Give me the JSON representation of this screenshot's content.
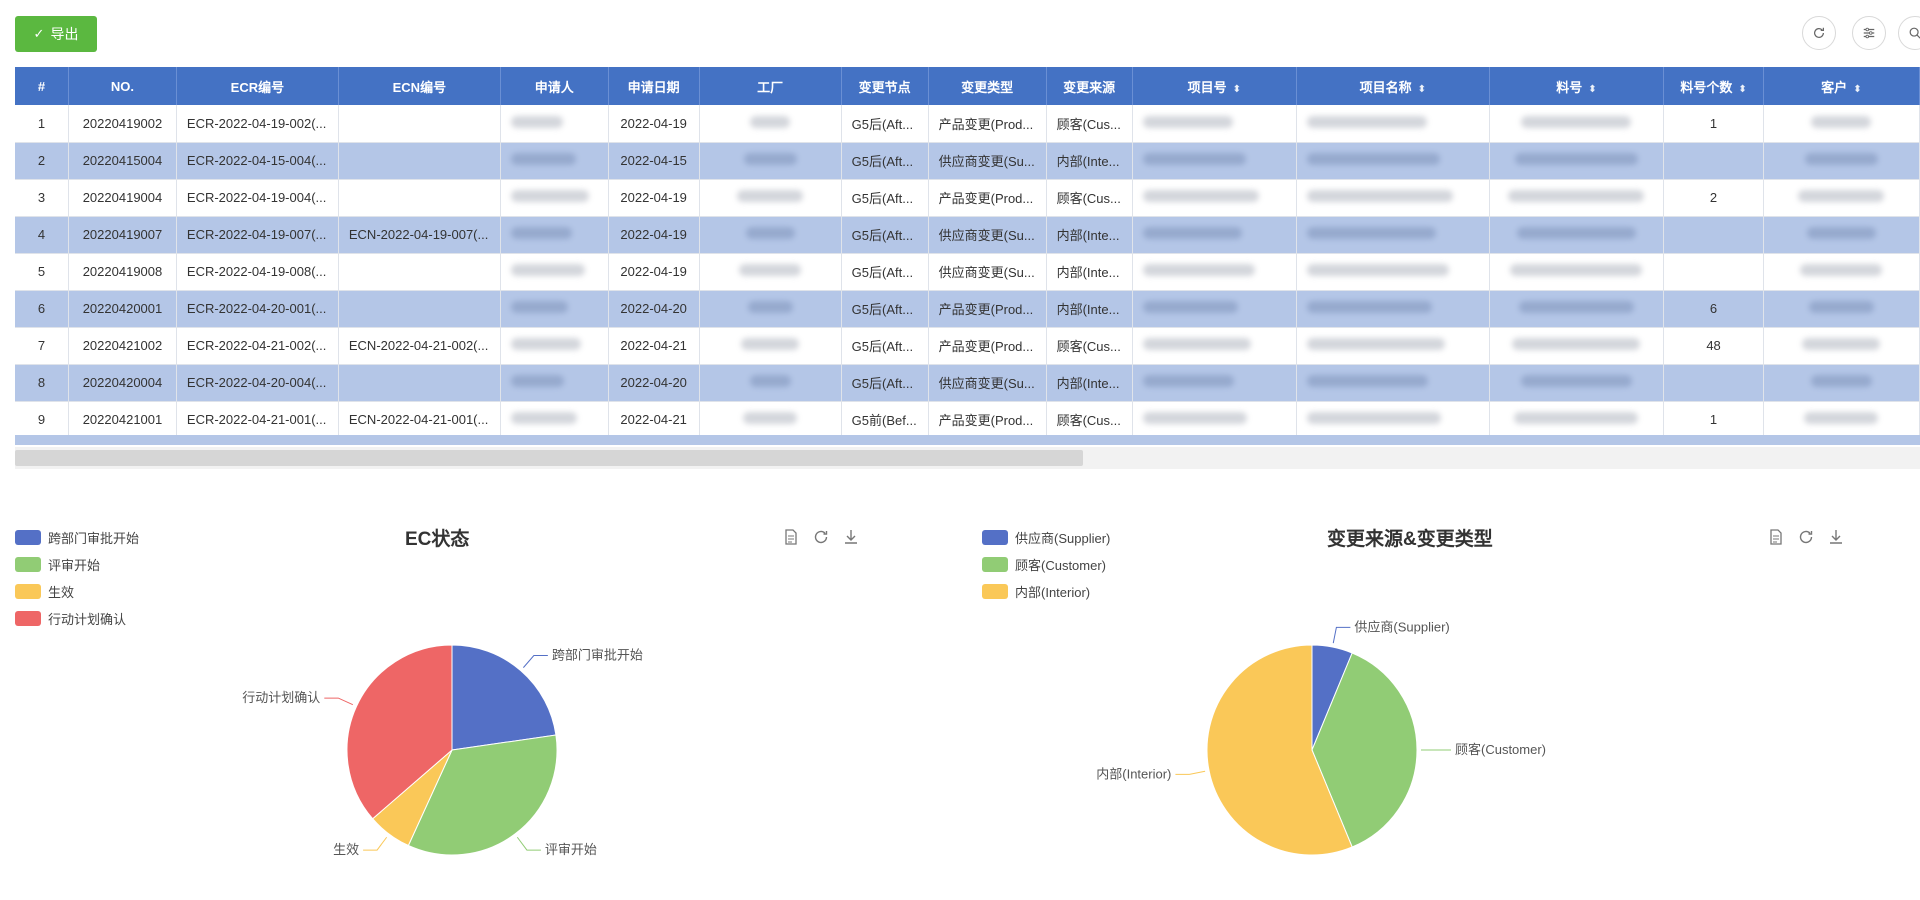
{
  "toolbar": {
    "export_label": "导出",
    "icons": [
      "refresh-icon",
      "filter-settings-icon",
      "search-icon"
    ]
  },
  "table": {
    "columns": [
      {
        "label": "#",
        "sortable": false
      },
      {
        "label": "NO.",
        "sortable": false
      },
      {
        "label": "ECR编号",
        "sortable": false
      },
      {
        "label": "ECN编号",
        "sortable": false
      },
      {
        "label": "申请人",
        "sortable": false
      },
      {
        "label": "申请日期",
        "sortable": false
      },
      {
        "label": "工厂",
        "sortable": false
      },
      {
        "label": "变更节点",
        "sortable": false
      },
      {
        "label": "变更类型",
        "sortable": false
      },
      {
        "label": "变更来源",
        "sortable": false
      },
      {
        "label": "项目号",
        "sortable": true
      },
      {
        "label": "项目名称",
        "sortable": true
      },
      {
        "label": "料号",
        "sortable": true
      },
      {
        "label": "料号个数",
        "sortable": true
      },
      {
        "label": "客户",
        "sortable": true
      }
    ],
    "rows": [
      {
        "idx": "1",
        "no": "20220419002",
        "ecr": "ECR-2022-04-19-002(...",
        "ecn": "",
        "date": "2022-04-19",
        "node": "G5后(Aft...",
        "type": "产品变更(Prod...",
        "source": "顾客(Cus...",
        "qty": "1"
      },
      {
        "idx": "2",
        "no": "20220415004",
        "ecr": "ECR-2022-04-15-004(...",
        "ecn": "",
        "date": "2022-04-15",
        "node": "G5后(Aft...",
        "type": "供应商变更(Su...",
        "source": "内部(Inte...",
        "qty": ""
      },
      {
        "idx": "3",
        "no": "20220419004",
        "ecr": "ECR-2022-04-19-004(...",
        "ecn": "",
        "date": "2022-04-19",
        "node": "G5后(Aft...",
        "type": "产品变更(Prod...",
        "source": "顾客(Cus...",
        "qty": "2"
      },
      {
        "idx": "4",
        "no": "20220419007",
        "ecr": "ECR-2022-04-19-007(...",
        "ecn": "ECN-2022-04-19-007(...",
        "date": "2022-04-19",
        "node": "G5后(Aft...",
        "type": "供应商变更(Su...",
        "source": "内部(Inte...",
        "qty": ""
      },
      {
        "idx": "5",
        "no": "20220419008",
        "ecr": "ECR-2022-04-19-008(...",
        "ecn": "",
        "date": "2022-04-19",
        "node": "G5后(Aft...",
        "type": "供应商变更(Su...",
        "source": "内部(Inte...",
        "qty": ""
      },
      {
        "idx": "6",
        "no": "20220420001",
        "ecr": "ECR-2022-04-20-001(...",
        "ecn": "",
        "date": "2022-04-20",
        "node": "G5后(Aft...",
        "type": "产品变更(Prod...",
        "source": "内部(Inte...",
        "qty": "6"
      },
      {
        "idx": "7",
        "no": "20220421002",
        "ecr": "ECR-2022-04-21-002(...",
        "ecn": "ECN-2022-04-21-002(...",
        "date": "2022-04-21",
        "node": "G5后(Aft...",
        "type": "产品变更(Prod...",
        "source": "顾客(Cus...",
        "qty": "48"
      },
      {
        "idx": "8",
        "no": "20220420004",
        "ecr": "ECR-2022-04-20-004(...",
        "ecn": "",
        "date": "2022-04-20",
        "node": "G5后(Aft...",
        "type": "供应商变更(Su...",
        "source": "内部(Inte...",
        "qty": ""
      },
      {
        "idx": "9",
        "no": "20220421001",
        "ecr": "ECR-2022-04-21-001(...",
        "ecn": "ECN-2022-04-21-001(...",
        "date": "2022-04-21",
        "node": "G5前(Bef...",
        "type": "产品变更(Prod...",
        "source": "顾客(Cus...",
        "qty": "1"
      }
    ]
  },
  "colors": {
    "header": "#4472c4",
    "row_highlight": "#b4c6e7",
    "export_button": "#5bb840",
    "blue": "#5470c6",
    "green": "#91cc75",
    "yellow": "#fac858",
    "red": "#ee6666"
  },
  "chart_data": [
    {
      "type": "pie",
      "title": "EC状态",
      "legend_position": "top-left",
      "categories": [
        "跨部门审批开始",
        "评审开始",
        "生效",
        "行动计划确认"
      ],
      "values": [
        2,
        3,
        0.6,
        3.2
      ],
      "colors": [
        "#5470c6",
        "#91cc75",
        "#fac858",
        "#ee6666"
      ]
    },
    {
      "type": "pie",
      "title": "变更来源&变更类型",
      "legend_position": "top-left",
      "categories": [
        "供应商(Supplier)",
        "顾客(Customer)",
        "内部(Interior)"
      ],
      "values": [
        1,
        6,
        9
      ],
      "colors": [
        "#5470c6",
        "#91cc75",
        "#fac858"
      ]
    }
  ]
}
